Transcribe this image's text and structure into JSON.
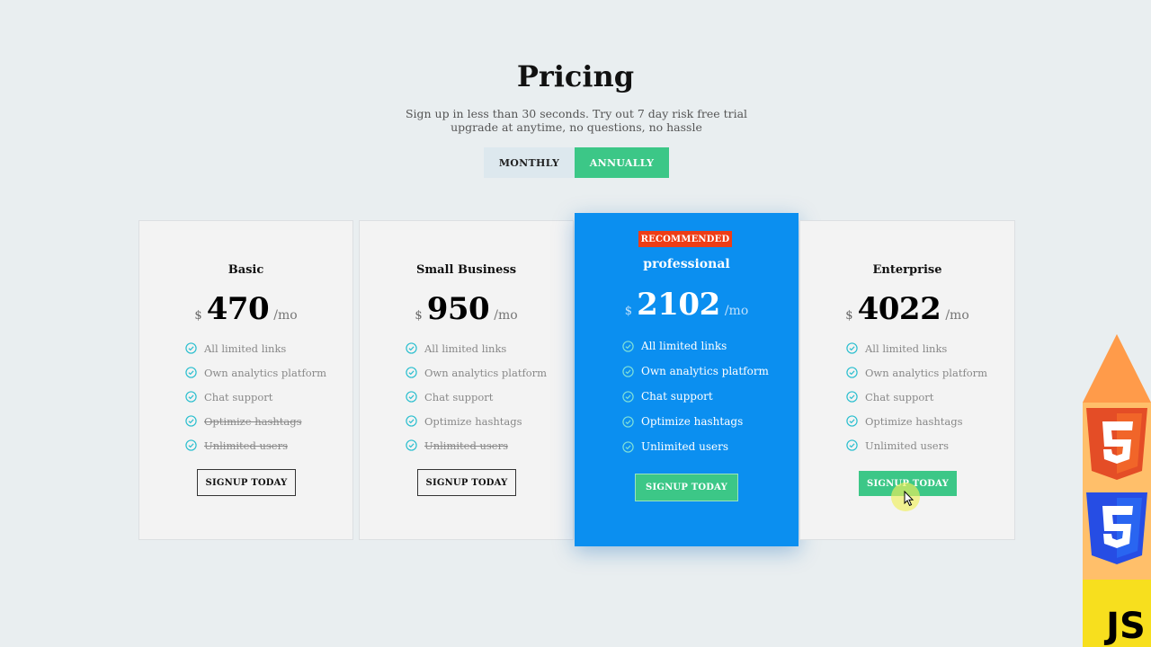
{
  "header": {
    "title": "Pricing",
    "subtitle": "Sign up in less than 30 seconds. Try out 7 day risk free trial upgrade at anytime, no questions, no hassle"
  },
  "billing_toggle": {
    "options": [
      "MONTHLY",
      "ANNUALLY"
    ],
    "selected": "ANNUALLY"
  },
  "plans": [
    {
      "name": "Basic",
      "currency": "$",
      "price": "470",
      "period": "/mo",
      "features": [
        "All limited links",
        "Own analytics platform",
        "Chat support",
        "Optimize hashtags",
        "Unlimited users"
      ],
      "disabled_features": [
        "Optimize hashtags",
        "Unlimited users"
      ],
      "button": "SIGNUP TODAY"
    },
    {
      "name": "Small Business",
      "currency": "$",
      "price": "950",
      "period": "/mo",
      "features": [
        "All limited links",
        "Own analytics platform",
        "Chat support",
        "Optimize hashtags",
        "Unlimited users"
      ],
      "disabled_features": [
        "Unlimited users"
      ],
      "button": "SIGNUP TODAY"
    },
    {
      "name": "professional",
      "badge": "RECOMMENDED",
      "currency": "$",
      "price": "2102",
      "period": "/mo",
      "features": [
        "All limited links",
        "Own analytics platform",
        "Chat support",
        "Optimize hashtags",
        "Unlimited users"
      ],
      "disabled_features": [],
      "button": "SIGNUP TODAY"
    },
    {
      "name": "Enterprise",
      "currency": "$",
      "price": "4022",
      "period": "/mo",
      "features": [
        "All limited links",
        "Own analytics platform",
        "Chat support",
        "Optimize hashtags",
        "Unlimited users"
      ],
      "disabled_features": [],
      "button": "SIGNUP TODAY"
    }
  ],
  "side_badges": {
    "html_icon": "html5-icon",
    "css_icon": "css3-icon",
    "js_label": "JS"
  },
  "colors": {
    "accent_green": "#3cc787",
    "recommended_blue": "#0b8ff0",
    "badge_red": "#ee3d16",
    "check_teal": "#2bbfcf"
  }
}
